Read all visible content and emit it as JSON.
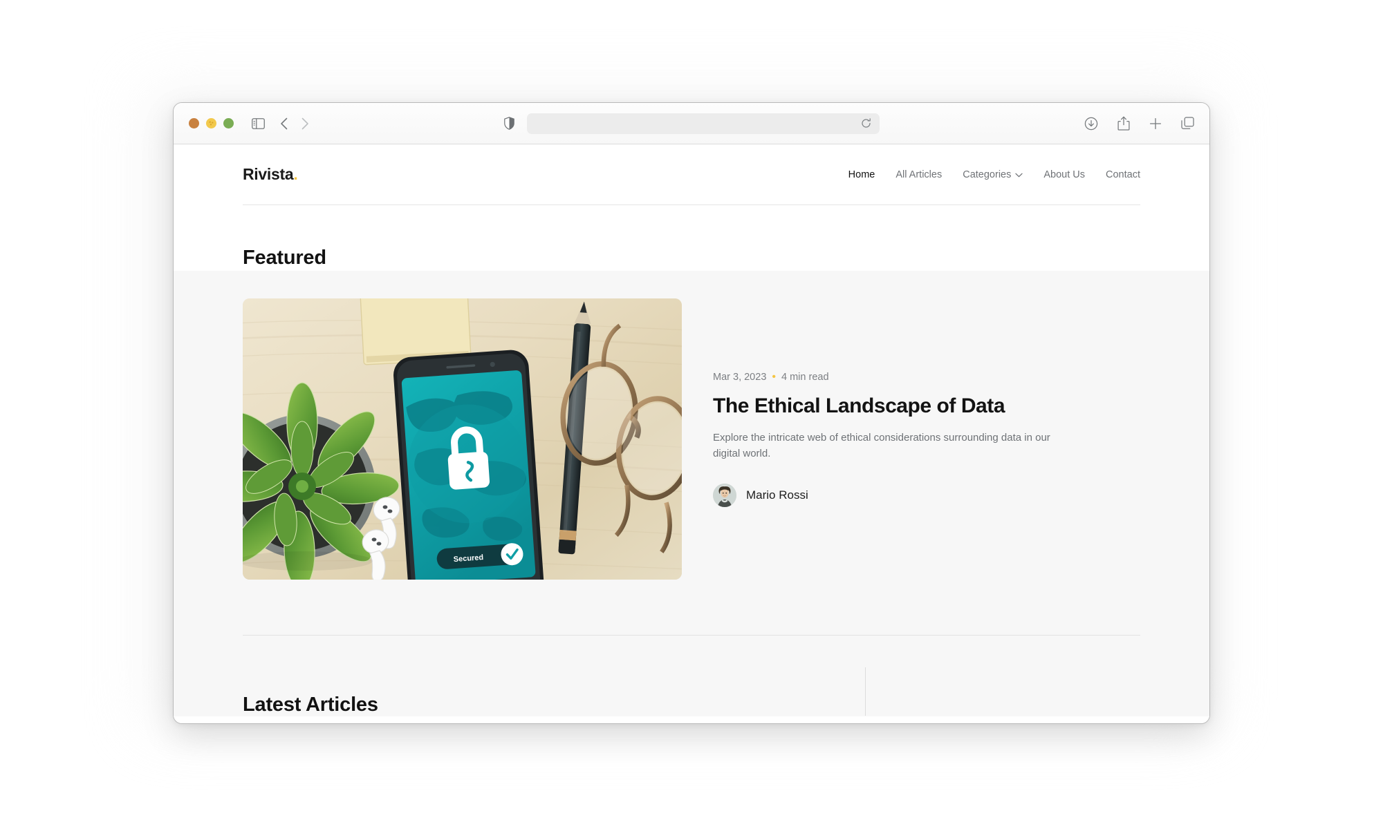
{
  "browser": {
    "window_controls": [
      {
        "name": "close",
        "color": "#c8813f"
      },
      {
        "name": "minimize",
        "color": "#f2c94c"
      },
      {
        "name": "maximize",
        "color": "#7aad54"
      }
    ],
    "sidebar_toggle_icon": "sidebar-icon",
    "back_icon": "chevron-left-icon",
    "forward_icon": "chevron-right-icon",
    "shield_icon": "shield-icon",
    "address": {
      "value": "",
      "placeholder": ""
    },
    "reload_icon": "reload-icon",
    "right_icons": [
      {
        "name": "downloads-icon"
      },
      {
        "name": "share-icon"
      },
      {
        "name": "new-tab-icon"
      },
      {
        "name": "tab-overview-icon"
      }
    ]
  },
  "site": {
    "brand": {
      "name": "Rivista",
      "dot": "."
    },
    "nav": [
      {
        "label": "Home",
        "active": true,
        "caret": false
      },
      {
        "label": "All Articles",
        "active": false,
        "caret": false
      },
      {
        "label": "Categories",
        "active": false,
        "caret": true
      },
      {
        "label": "About Us",
        "active": false,
        "caret": false
      },
      {
        "label": "Contact",
        "active": false,
        "caret": false
      }
    ]
  },
  "featured": {
    "heading": "Featured",
    "highlight_color": "#fbc741",
    "article": {
      "date": "Mar 3, 2023",
      "separator": "•",
      "read_time": "4 min read",
      "title": "The Ethical Landscape of Data",
      "excerpt": "Explore the intricate web of ethical considerations surrounding data in our digital world.",
      "author": "Mario Rossi",
      "image_alt": "Flat lay of a smartphone showing a teal VPN security screen with a padlock, beside a succulent plant, wireless earbuds, a pencil and eyeglasses on light wood",
      "image_badge": "Secured"
    }
  },
  "latest": {
    "heading": "Latest Articles"
  },
  "colors": {
    "accent": "#f5c542",
    "highlight": "#fbc741",
    "page_bg": "#f7f7f7",
    "header_bg": "#ffffff",
    "text_primary": "#131313",
    "text_muted": "#6e7276"
  }
}
